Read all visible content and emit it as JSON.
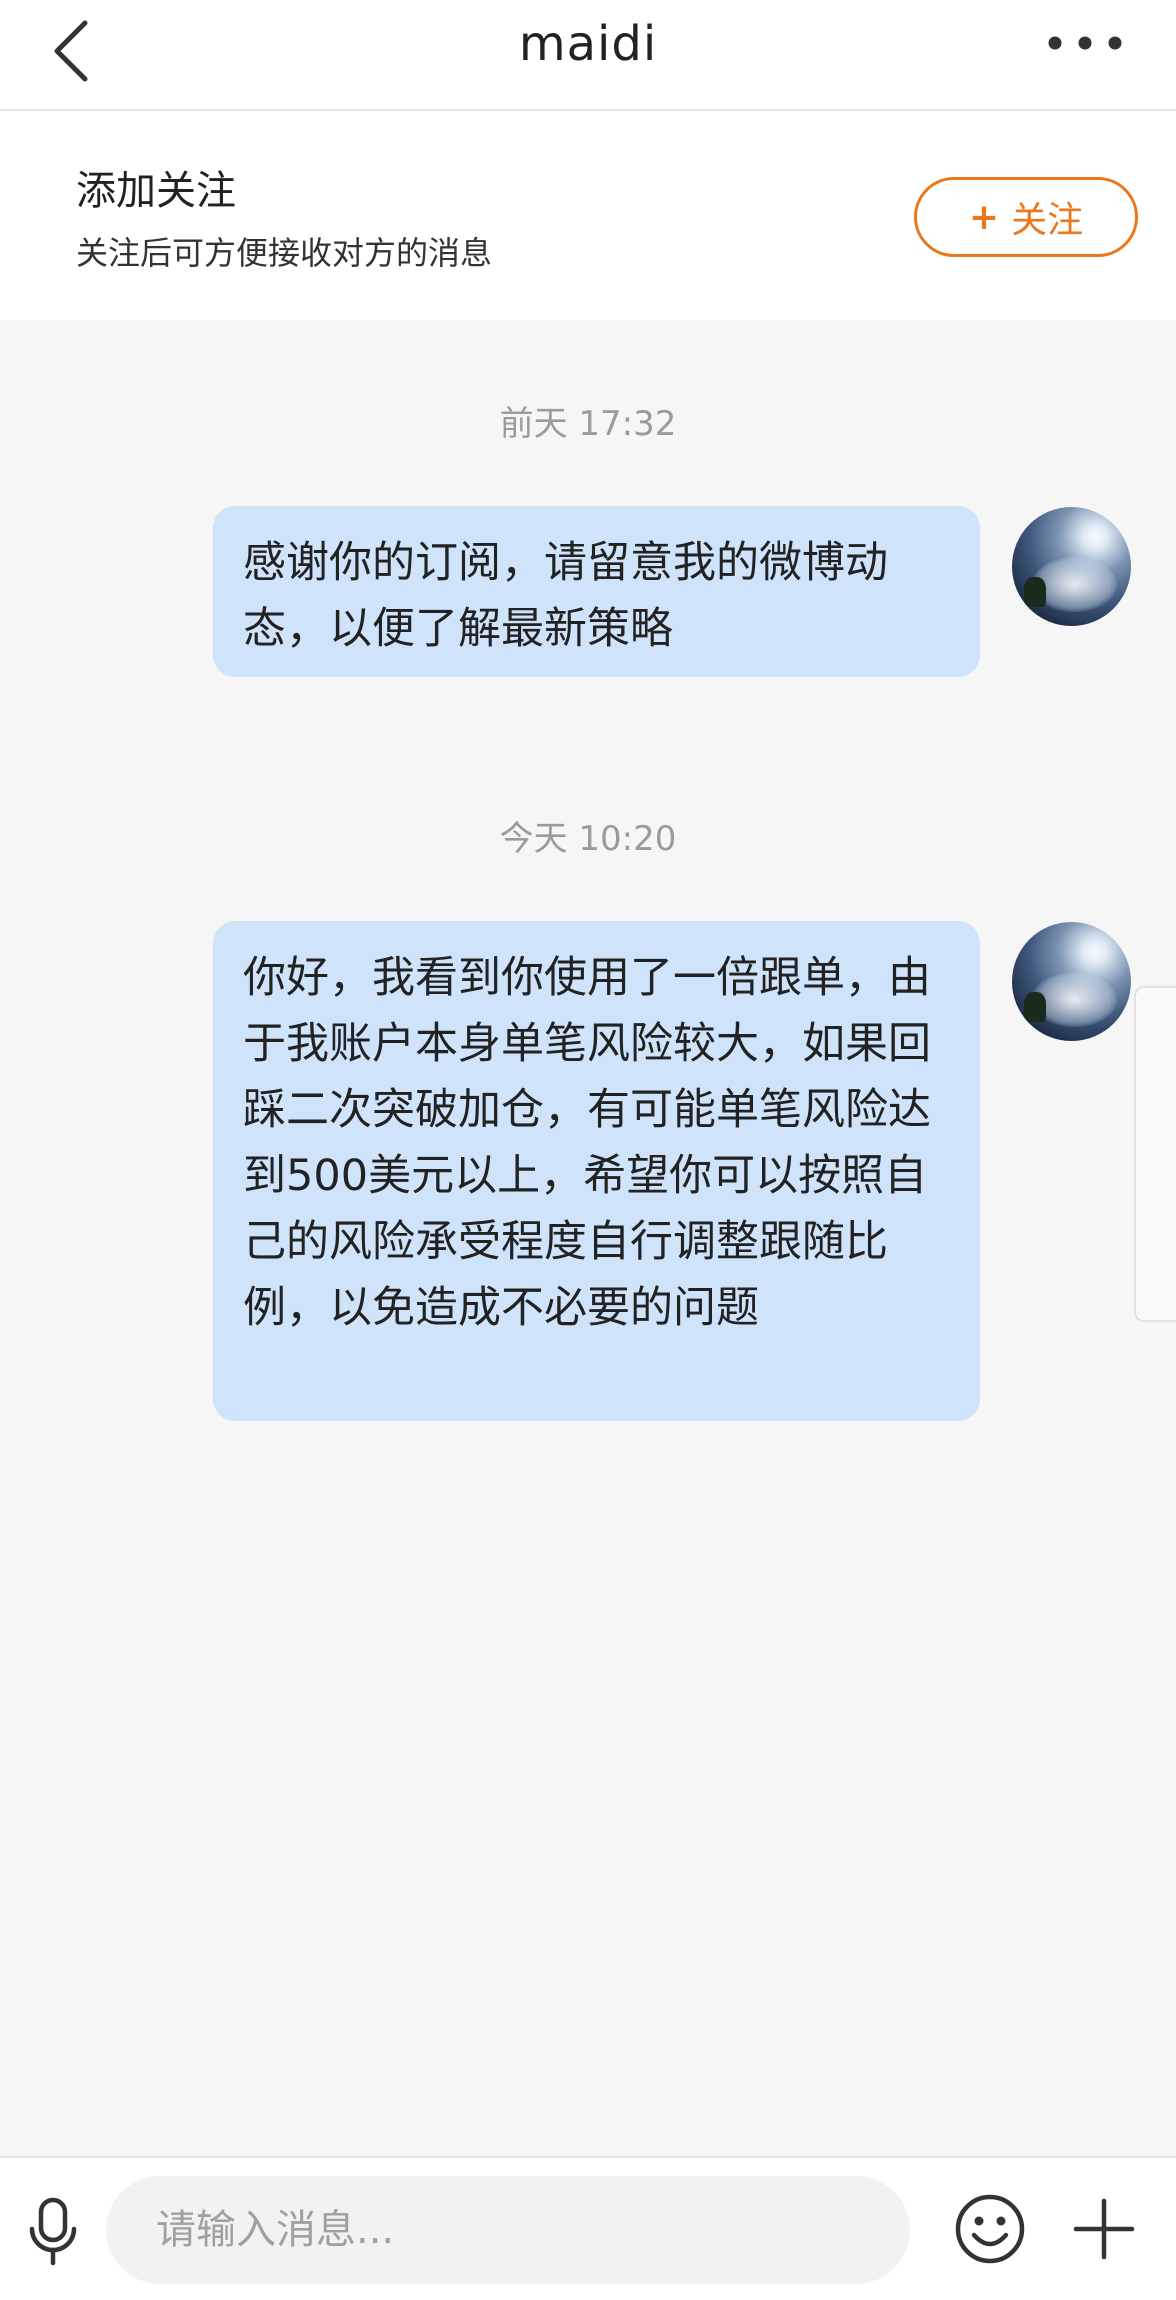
{
  "header": {
    "title": "maidi",
    "back_icon": "chevron-left-icon",
    "more_icon": "more-dots-icon"
  },
  "follow_banner": {
    "title": "添加关注",
    "description": "关注后可方便接收对方的消息",
    "button_label": "关注",
    "button_plus": "+",
    "accent_color": "#e9781d"
  },
  "messages": [
    {
      "timestamp": "前天 17:32",
      "text": "感谢你的订阅，请留意我的微博动态，以便了解最新策略"
    },
    {
      "timestamp": "今天 10:20",
      "text": "你好，我看到你使用了一倍跟单，由于我账户本身单笔风险较大，如果回踩二次突破加仓，有可能单笔风险达到500美元以上，希望你可以按照自己的风险承受程度自行调整跟随比例，以免造成不必要的问题"
    }
  ],
  "input_bar": {
    "placeholder": "请输入消息...",
    "value": "",
    "mic_icon": "microphone-icon",
    "emoji_icon": "emoji-icon",
    "plus_icon": "plus-icon"
  },
  "colors": {
    "bubble": "#cfe4fb",
    "background": "#f6f6f6",
    "timestamp": "#9b9b9b"
  }
}
